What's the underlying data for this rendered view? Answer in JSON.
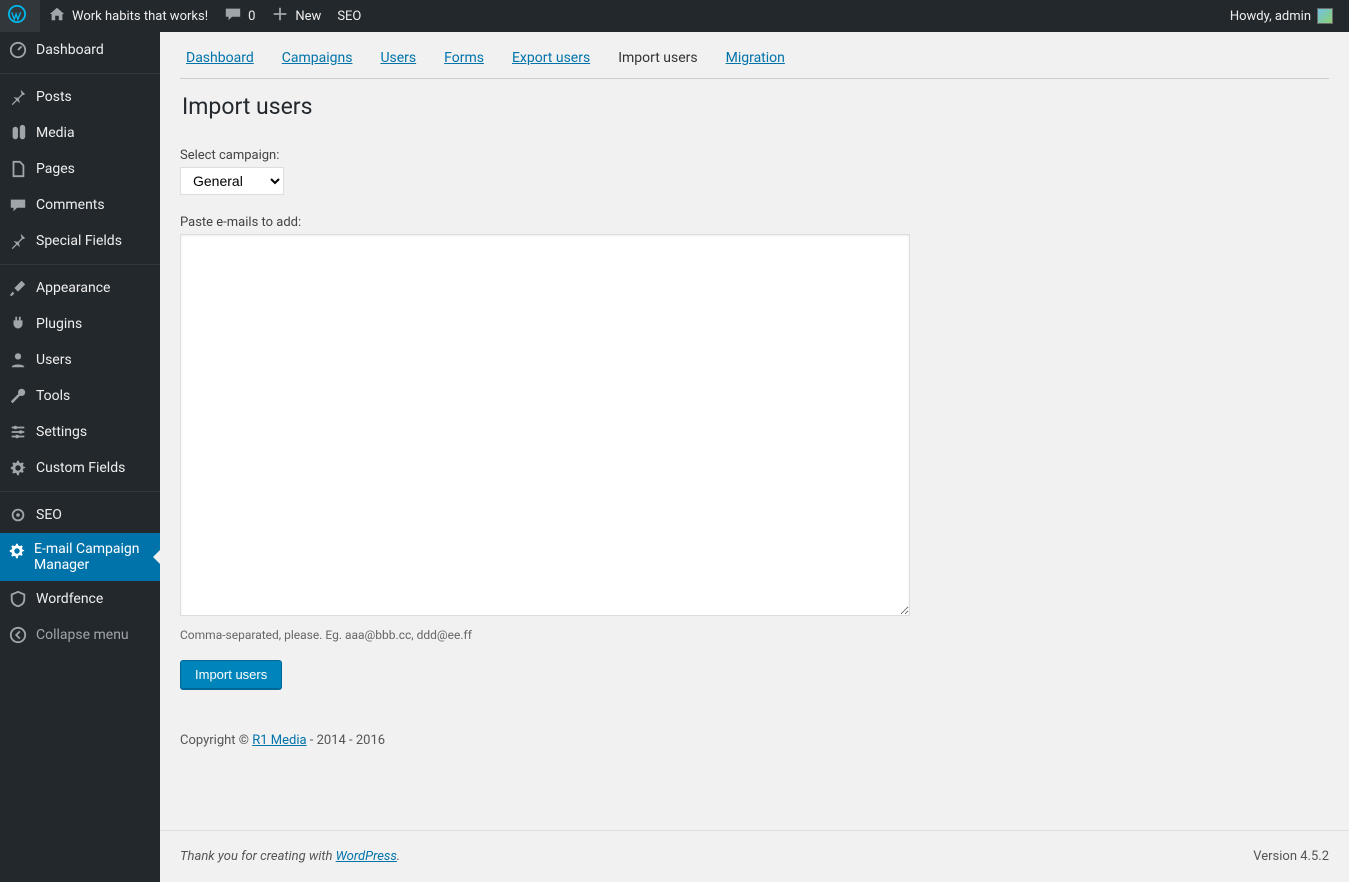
{
  "adminbar": {
    "site_title": "Work habits that works!",
    "comments_count": "0",
    "new_label": "New",
    "seo_label": "SEO",
    "howdy": "Howdy, admin"
  },
  "sidebar": {
    "items": [
      {
        "type": "item",
        "icon": "dashboard-icon",
        "label": "Dashboard"
      },
      {
        "type": "sep"
      },
      {
        "type": "item",
        "icon": "pin-icon",
        "label": "Posts"
      },
      {
        "type": "item",
        "icon": "media-icon",
        "label": "Media"
      },
      {
        "type": "item",
        "icon": "page-icon",
        "label": "Pages"
      },
      {
        "type": "item",
        "icon": "comment-icon",
        "label": "Comments"
      },
      {
        "type": "item",
        "icon": "pin-icon",
        "label": "Special Fields"
      },
      {
        "type": "sep"
      },
      {
        "type": "item",
        "icon": "brush-icon",
        "label": "Appearance"
      },
      {
        "type": "item",
        "icon": "plug-icon",
        "label": "Plugins"
      },
      {
        "type": "item",
        "icon": "user-icon",
        "label": "Users"
      },
      {
        "type": "item",
        "icon": "wrench-icon",
        "label": "Tools"
      },
      {
        "type": "item",
        "icon": "sliders-icon",
        "label": "Settings"
      },
      {
        "type": "item",
        "icon": "gear-icon",
        "label": "Custom Fields"
      },
      {
        "type": "sep"
      },
      {
        "type": "item",
        "icon": "seo-icon",
        "label": "SEO"
      },
      {
        "type": "item",
        "icon": "gear-icon",
        "label": "E-mail Campaign Manager",
        "current": true,
        "multiline": true
      },
      {
        "type": "item",
        "icon": "shield-icon",
        "label": "Wordfence"
      },
      {
        "type": "item",
        "icon": "collapse-icon",
        "label": "Collapse menu",
        "dim": true
      }
    ]
  },
  "tabs": [
    {
      "label": "Dashboard"
    },
    {
      "label": "Campaigns"
    },
    {
      "label": "Users"
    },
    {
      "label": "Forms"
    },
    {
      "label": "Export users"
    },
    {
      "label": "Import users",
      "active": true
    },
    {
      "label": "Migration"
    }
  ],
  "page": {
    "title": "Import users",
    "select_label": "Select campaign:",
    "select_value": "General",
    "textarea_label": "Paste e-mails to add:",
    "textarea_value": "",
    "hint": "Comma-separated, please. Eg. aaa@bbb.cc, ddd@ee.ff",
    "submit": "Import users"
  },
  "copyright": {
    "prefix": "Copyright © ",
    "link": "R1 Media",
    "suffix": " - 2014 - 2016"
  },
  "footer": {
    "thanks_prefix": "Thank you for creating with ",
    "thanks_link": "WordPress",
    "thanks_suffix": ".",
    "version": "Version 4.5.2"
  }
}
